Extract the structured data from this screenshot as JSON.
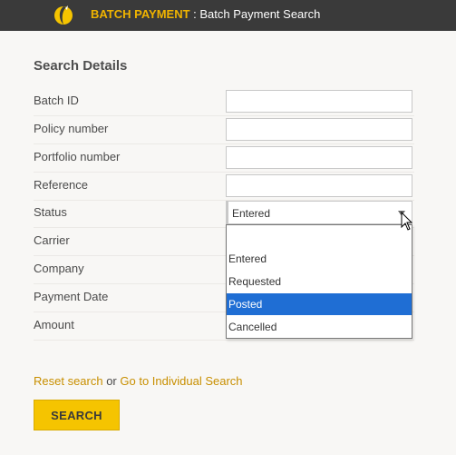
{
  "header": {
    "module": "BATCH PAYMENT",
    "separator": " : ",
    "page": "Batch Payment Search"
  },
  "search": {
    "title": "Search Details",
    "fields": [
      {
        "label": "Batch ID",
        "value": ""
      },
      {
        "label": "Policy number",
        "value": ""
      },
      {
        "label": "Portfolio number",
        "value": ""
      },
      {
        "label": "Reference",
        "value": ""
      },
      {
        "label": "Status",
        "value": "Entered"
      },
      {
        "label": "Carrier",
        "value": ""
      },
      {
        "label": "Company",
        "value": ""
      },
      {
        "label": "Payment Date",
        "value": ""
      },
      {
        "label": "Amount",
        "value": ""
      }
    ],
    "status_options": [
      {
        "label": "",
        "selected": false
      },
      {
        "label": "Entered",
        "selected": false
      },
      {
        "label": "Requested",
        "selected": false
      },
      {
        "label": "Posted",
        "selected": true
      },
      {
        "label": "Cancelled",
        "selected": false
      }
    ]
  },
  "links": {
    "reset": "Reset search",
    "or": " or ",
    "individual": "Go to Individual Search"
  },
  "button": {
    "search": "SEARCH"
  },
  "colors": {
    "header_bg": "#3a3a3a",
    "accent": "#f0b400",
    "link": "#c88f00",
    "button_bg": "#f5c400",
    "selected_option": "#1f6ed4"
  },
  "icons": {
    "logo": "logo-icon",
    "dropdown_arrow": "chevron-down-icon",
    "cursor": "mouse-cursor-icon"
  }
}
